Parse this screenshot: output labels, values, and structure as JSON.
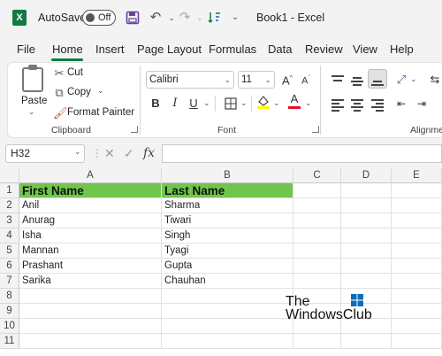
{
  "titlebar": {
    "autosave_label": "AutoSave",
    "autosave_state": "Off",
    "book_title": "Book1  -  Excel"
  },
  "tabs": [
    "File",
    "Home",
    "Insert",
    "Page Layout",
    "Formulas",
    "Data",
    "Review",
    "View",
    "Help"
  ],
  "active_tab": "Home",
  "ribbon": {
    "clipboard": {
      "paste_label": "Paste",
      "cut_label": "Cut",
      "copy_label": "Copy",
      "format_painter_label": "Format Painter",
      "group_label": "Clipboard"
    },
    "font": {
      "font_name": "Calibri",
      "font_size": "11",
      "grow_label": "A",
      "shrink_label": "A",
      "bold": "B",
      "italic": "I",
      "underline": "U",
      "group_label": "Font",
      "fill_color": "#ffff00",
      "font_color": "#e81123"
    },
    "alignment": {
      "group_label": "Alignmer"
    }
  },
  "formula_bar": {
    "name_box": "H32",
    "fx": "fx",
    "formula": ""
  },
  "grid": {
    "columns": [
      "A",
      "B",
      "C",
      "D",
      "E"
    ],
    "rows": [
      "1",
      "2",
      "3",
      "4",
      "5",
      "6",
      "7",
      "8",
      "9",
      "10",
      "11"
    ],
    "header_fill": "#70c64d",
    "cells": [
      [
        "First Name",
        "Last Name"
      ],
      [
        "Anil",
        "Sharma"
      ],
      [
        "Anurag",
        "Tiwari"
      ],
      [
        "Isha",
        "Singh"
      ],
      [
        "Mannan",
        "Tyagi"
      ],
      [
        "Prashant",
        "Gupta"
      ],
      [
        "Sarika",
        "Chauhan"
      ]
    ]
  },
  "watermark": {
    "line1": "The",
    "line2": "WindowsClub"
  }
}
